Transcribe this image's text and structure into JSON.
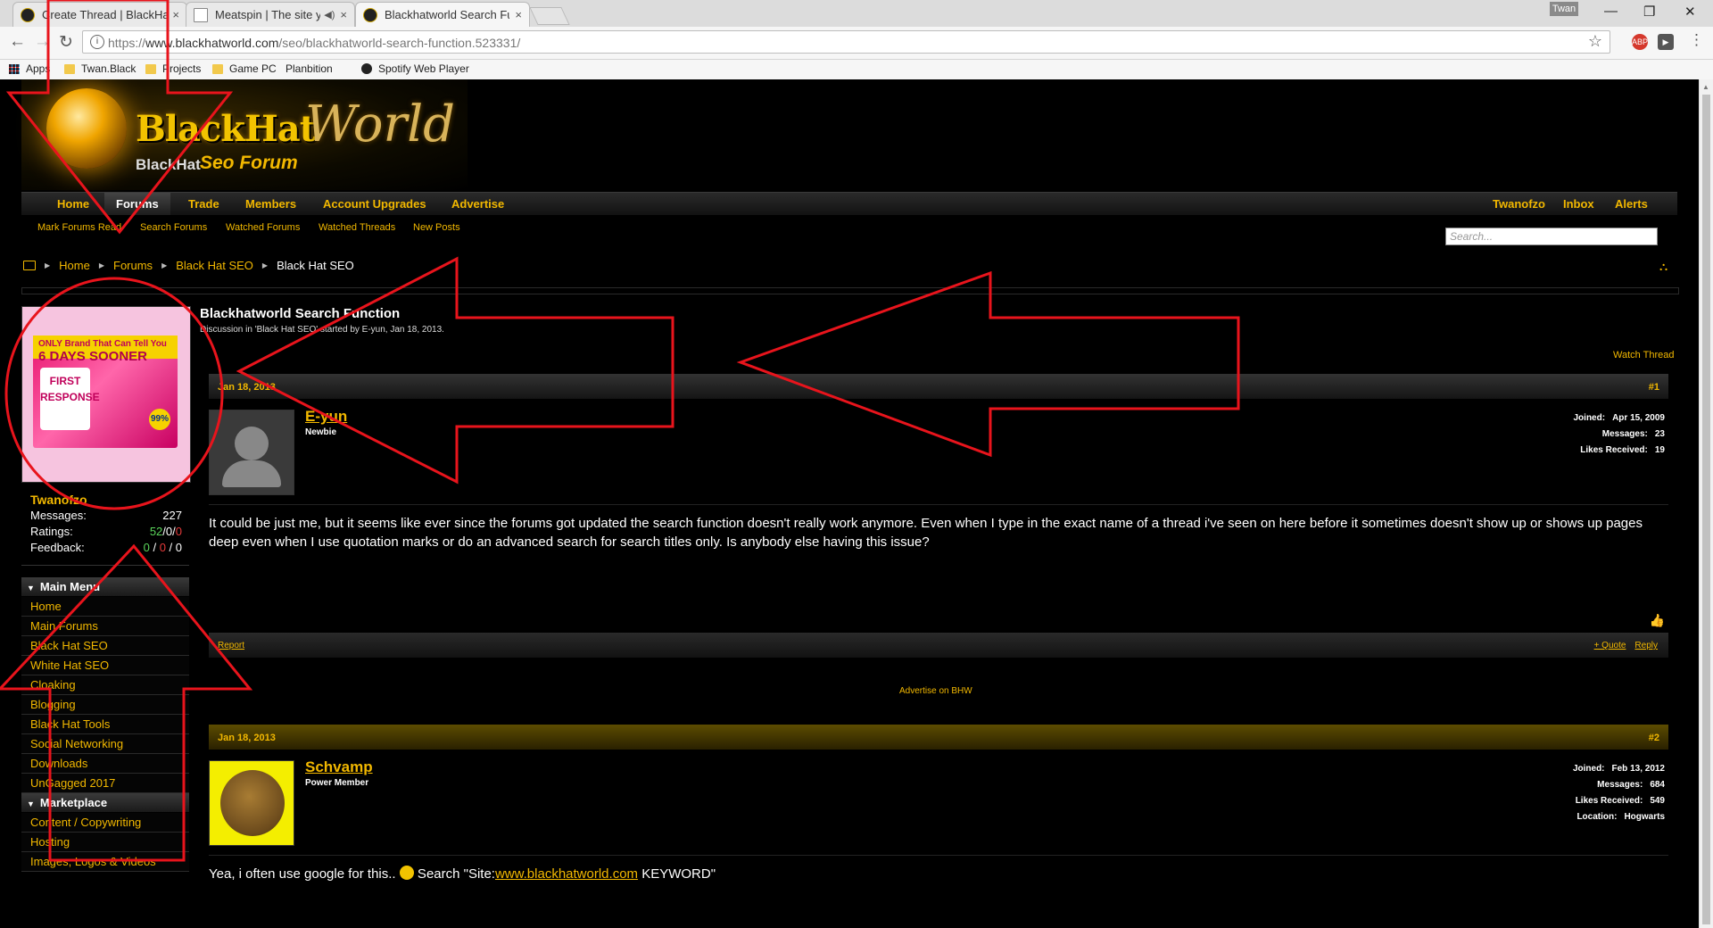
{
  "browser": {
    "tabs": [
      {
        "title": "Create Thread | BlackHat",
        "close": "×"
      },
      {
        "title": "Meatspin | The site yo",
        "close": "×"
      },
      {
        "title": "Blackhatworld Search Fu",
        "close": "×"
      }
    ],
    "user": "Twan",
    "url_scheme": "https://",
    "url_host": "www.blackhatworld.com",
    "url_path": "/seo/blackhatworld-search-function.523331/",
    "bookmarks": [
      "Apps",
      "Twan.Black",
      "Projects",
      "Game PC",
      "Planbition",
      "Spotify Web Player"
    ],
    "ext_badge": "ABP"
  },
  "site": {
    "logo_main": "BlackHat",
    "logo_world": "World",
    "logo_sub1": "BlackHat",
    "logo_sub2": "Seo Forum",
    "nav_left": [
      "Home",
      "Forums",
      "Trade",
      "Members",
      "Account Upgrades",
      "Advertise"
    ],
    "nav_right": [
      "Twanofzo",
      "Inbox",
      "Alerts"
    ],
    "subnav": [
      "Mark Forums Read",
      "Search Forums",
      "Watched Forums",
      "Watched Threads",
      "New Posts"
    ],
    "search_placeholder": "Search...",
    "breadcrumbs": [
      "Home",
      "Forums",
      "Black Hat SEO",
      "Black Hat SEO"
    ]
  },
  "sidebar": {
    "username": "Twanofzo",
    "stats": {
      "messages_label": "Messages:",
      "messages": "227",
      "ratings_label": "Ratings:",
      "ratings_a": "52",
      "ratings_b": "0",
      "ratings_c": "0",
      "feedback_label": "Feedback:",
      "feedback_a": "0",
      "feedback_b": "0",
      "feedback_c": "0"
    },
    "menu_title": "Main Menu",
    "menu_items": [
      "Home",
      "Main Forums",
      "Black Hat SEO",
      "White Hat SEO",
      "Cloaking",
      "Blogging",
      "Black Hat Tools",
      "Social Networking",
      "Downloads",
      "UnGagged 2017"
    ],
    "market_title": "Marketplace",
    "market_items": [
      "Content / Copywriting",
      "Hosting",
      "Images, Logos & Videos"
    ],
    "ad": {
      "band_pre": "ONLY Brand That Can Tell You",
      "band_days": "6 DAYS SOONER",
      "brand": "FIRST RESPONSE",
      "pct": "99%"
    }
  },
  "thread": {
    "title": "Blackhatworld Search Function",
    "desc": "Discussion in 'Black Hat SEO' started by E-yun, Jan 18, 2013.",
    "watch": "Watch Thread",
    "advertise": "Advertise on BHW",
    "posts": [
      {
        "date": "Jan 18, 2013",
        "num": "#1",
        "author": "E-yun",
        "role": "Newbie",
        "meta": [
          [
            "Joined:",
            "Apr 15, 2009"
          ],
          [
            "Messages:",
            "23"
          ],
          [
            "Likes Received:",
            "19"
          ]
        ],
        "body": "It could be just me, but it seems like ever since the forums got updated the search function doesn't really work anymore. Even when I type in the exact name of a thread i've seen on here before it sometimes doesn't show up or shows up pages deep even when I use quotation marks or do an advanced search for search titles only. Is anybody else having this issue?",
        "report": "Report",
        "quote": "+ Quote",
        "reply": "Reply"
      },
      {
        "date": "Jan 18, 2013",
        "num": "#2",
        "author": "Schvamp",
        "role": "Power Member",
        "meta": [
          [
            "Joined:",
            "Feb 13, 2012"
          ],
          [
            "Messages:",
            "684"
          ],
          [
            "Likes Received:",
            "549"
          ],
          [
            "Location:",
            "Hogwarts"
          ]
        ],
        "body_pre": "Yea, i often use google for this..",
        "body_mid": " Search \"Site:",
        "body_link": "www.blackhatworld.com",
        "body_post": " KEYWORD\""
      }
    ]
  },
  "colors": {
    "accent": "#f2b800",
    "annotation": "#e8141c",
    "background": "#000000"
  }
}
